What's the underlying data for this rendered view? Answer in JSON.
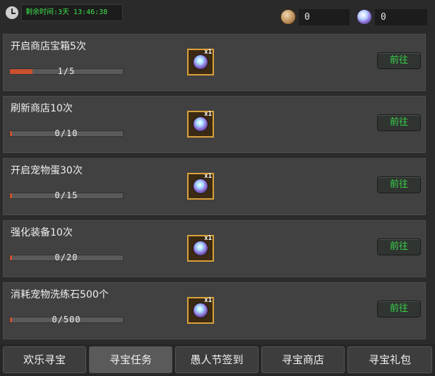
{
  "header": {
    "timer_text": "剩余时间:3天 13:46:38",
    "currencies": [
      {
        "icon": "coin-icon",
        "value": "0"
      },
      {
        "icon": "gem-icon",
        "value": "0"
      }
    ]
  },
  "tasks": [
    {
      "title": "开启商店宝箱5次",
      "progress_text": "1/5",
      "progress": 0.2,
      "reward_qty": "x1",
      "button_label": "前往"
    },
    {
      "title": "刷新商店10次",
      "progress_text": "0/10",
      "progress": 0.0,
      "reward_qty": "x1",
      "button_label": "前往"
    },
    {
      "title": "开启宠物蛋30次",
      "progress_text": "0/15",
      "progress": 0.0,
      "reward_qty": "x1",
      "button_label": "前往"
    },
    {
      "title": "强化装备10次",
      "progress_text": "0/20",
      "progress": 0.0,
      "reward_qty": "x1",
      "button_label": "前往"
    },
    {
      "title": "消耗宠物洗练石500个",
      "progress_text": "0/500",
      "progress": 0.0,
      "reward_qty": "x1",
      "button_label": "前往"
    }
  ],
  "tabs": [
    {
      "label": "欢乐寻宝",
      "active": false
    },
    {
      "label": "寻宝任务",
      "active": true
    },
    {
      "label": "愚人节签到",
      "active": false
    },
    {
      "label": "寻宝商店",
      "active": false
    },
    {
      "label": "寻宝礼包",
      "active": false
    }
  ],
  "colors": {
    "timer_text": "#3fe24a",
    "progress_fill": "#c9512f",
    "go_button_text": "#39d44a",
    "reward_border": "#d9a23a"
  }
}
